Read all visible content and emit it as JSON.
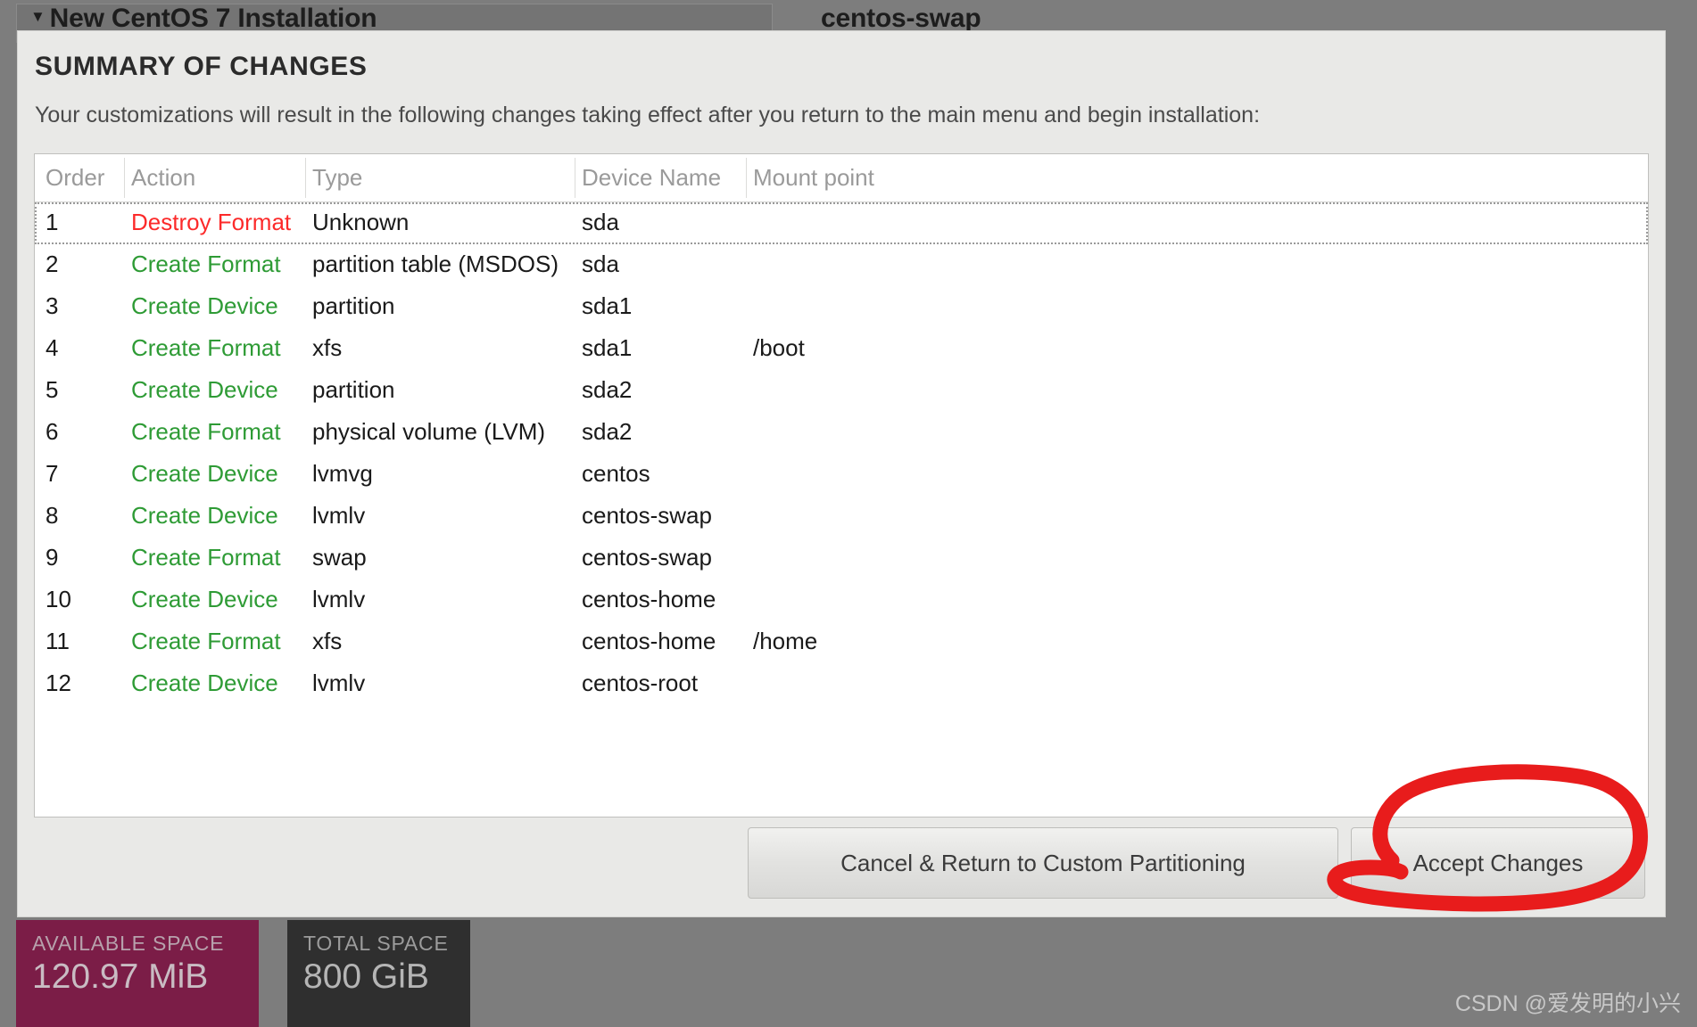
{
  "background": {
    "left_label": "New CentOS 7 Installation",
    "left_caret": "▼",
    "right_label": "centos-swap"
  },
  "dialog": {
    "title": "SUMMARY OF CHANGES",
    "description": "Your customizations will result in the following changes taking effect after you return to the main menu and begin installation:",
    "table": {
      "columns": [
        "Order",
        "Action",
        "Type",
        "Device Name",
        "Mount point"
      ],
      "rows": [
        {
          "order": "1",
          "action": "Destroy Format",
          "action_kind": "destroy",
          "type": "Unknown",
          "device": "sda",
          "mount": "",
          "focused": true
        },
        {
          "order": "2",
          "action": "Create Format",
          "action_kind": "create",
          "type": "partition table (MSDOS)",
          "device": "sda",
          "mount": "",
          "focused": false
        },
        {
          "order": "3",
          "action": "Create Device",
          "action_kind": "create",
          "type": "partition",
          "device": "sda1",
          "mount": "",
          "focused": false
        },
        {
          "order": "4",
          "action": "Create Format",
          "action_kind": "create",
          "type": "xfs",
          "device": "sda1",
          "mount": "/boot",
          "focused": false
        },
        {
          "order": "5",
          "action": "Create Device",
          "action_kind": "create",
          "type": "partition",
          "device": "sda2",
          "mount": "",
          "focused": false
        },
        {
          "order": "6",
          "action": "Create Format",
          "action_kind": "create",
          "type": "physical volume (LVM)",
          "device": "sda2",
          "mount": "",
          "focused": false
        },
        {
          "order": "7",
          "action": "Create Device",
          "action_kind": "create",
          "type": "lvmvg",
          "device": "centos",
          "mount": "",
          "focused": false
        },
        {
          "order": "8",
          "action": "Create Device",
          "action_kind": "create",
          "type": "lvmlv",
          "device": "centos-swap",
          "mount": "",
          "focused": false
        },
        {
          "order": "9",
          "action": "Create Format",
          "action_kind": "create",
          "type": "swap",
          "device": "centos-swap",
          "mount": "",
          "focused": false
        },
        {
          "order": "10",
          "action": "Create Device",
          "action_kind": "create",
          "type": "lvmlv",
          "device": "centos-home",
          "mount": "",
          "focused": false
        },
        {
          "order": "11",
          "action": "Create Format",
          "action_kind": "create",
          "type": "xfs",
          "device": "centos-home",
          "mount": "/home",
          "focused": false
        },
        {
          "order": "12",
          "action": "Create Device",
          "action_kind": "create",
          "type": "lvmlv",
          "device": "centos-root",
          "mount": "",
          "focused": false
        }
      ]
    },
    "buttons": {
      "cancel": "Cancel & Return to Custom Partitioning",
      "accept": "Accept Changes"
    }
  },
  "annotation": {
    "shape": "red-ellipse-highlight",
    "target": "Accept Changes",
    "color": "#e81c1c"
  },
  "status_boxes": [
    {
      "label": "AVAILABLE SPACE",
      "value": "120.97 MiB",
      "color": "#7b1d47",
      "name": "available-space"
    },
    {
      "label": "TOTAL SPACE",
      "value": "800 GiB",
      "color": "#2f2f2f",
      "name": "total-space"
    }
  ],
  "watermark": "CSDN @爱发明的小兴",
  "colors": {
    "destroy": "#fc2a2a",
    "create": "#2e9b35",
    "dialog_bg": "#e9e9e7",
    "desktop_bg": "#7d7d7d"
  }
}
